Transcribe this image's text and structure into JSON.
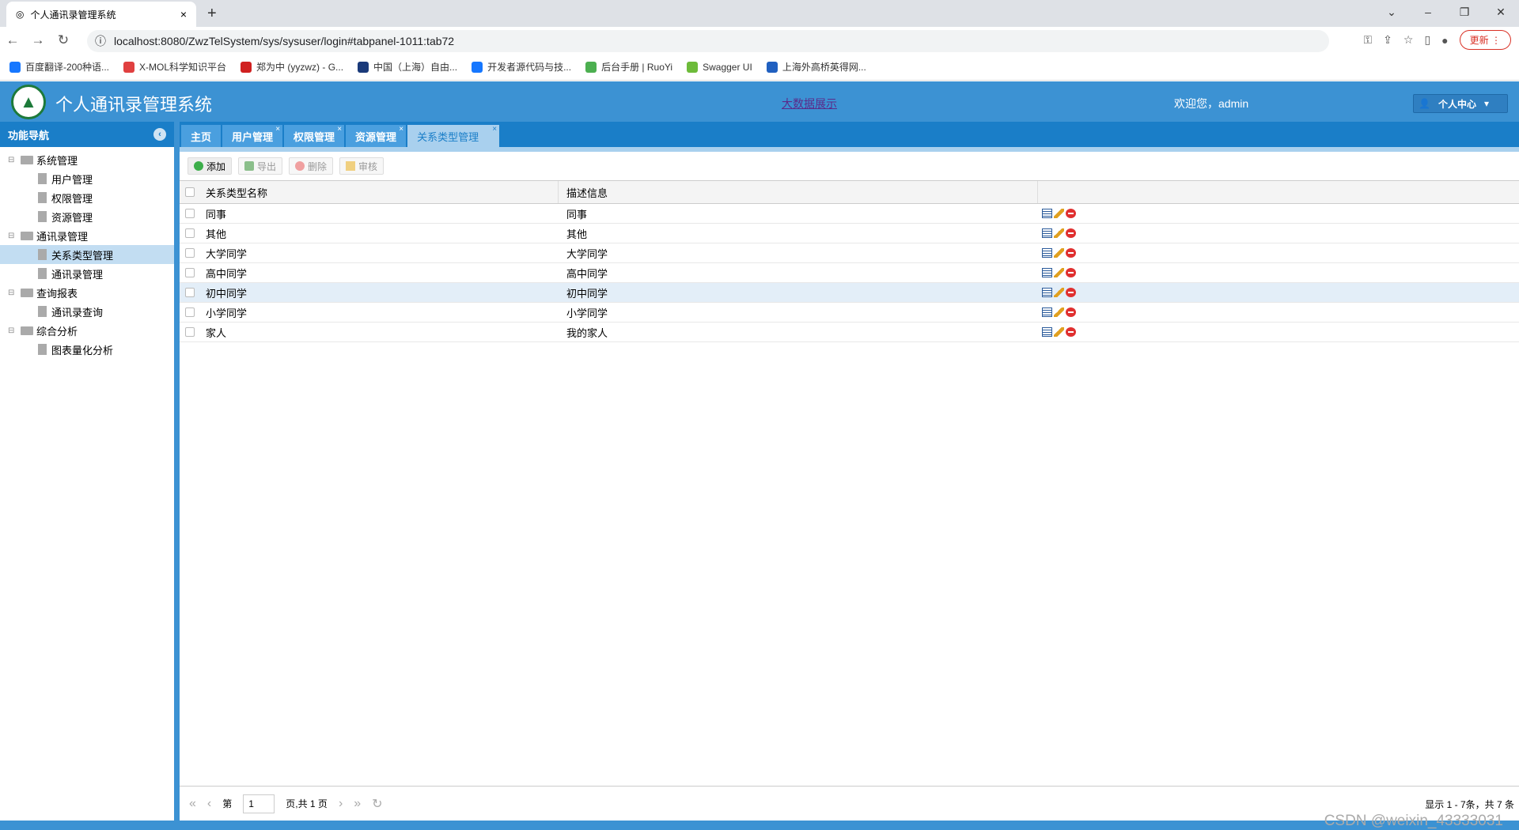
{
  "browser": {
    "tab_title": "个人通讯录管理系统",
    "url": "localhost:8080/ZwzTelSystem/sys/sysuser/login#tabpanel-1011:tab72",
    "update_label": "更新",
    "bookmarks": [
      "百度翻译-200种语...",
      "X-MOL科学知识平台",
      "郑为中 (yyzwz) - G...",
      "中国（上海）自由...",
      "开发者源代码与技...",
      "后台手册 | RuoYi",
      "Swagger UI",
      "上海外高桥英得网..."
    ]
  },
  "header": {
    "title": "个人通讯录管理系统",
    "bigdata_link": "大数据展示",
    "welcome": "欢迎您，admin",
    "personal_center": "个人中心"
  },
  "sidebar": {
    "title": "功能导航",
    "tree": [
      {
        "label": "系统管理",
        "children": [
          "用户管理",
          "权限管理",
          "资源管理"
        ]
      },
      {
        "label": "通讯录管理",
        "children": [
          "关系类型管理",
          "通讯录管理"
        ]
      },
      {
        "label": "查询报表",
        "children": [
          "通讯录查询"
        ]
      },
      {
        "label": "综合分析",
        "children": [
          "图表量化分析"
        ]
      }
    ],
    "selected": "关系类型管理"
  },
  "tabs": [
    {
      "label": "主页",
      "closable": false
    },
    {
      "label": "用户管理",
      "closable": true
    },
    {
      "label": "权限管理",
      "closable": true
    },
    {
      "label": "资源管理",
      "closable": true
    },
    {
      "label": "关系类型管理",
      "closable": true,
      "active": true
    }
  ],
  "toolbar": {
    "add": "添加",
    "export": "导出",
    "delete": "删除",
    "audit": "审核"
  },
  "grid": {
    "columns": [
      "关系类型名称",
      "描述信息"
    ],
    "rows": [
      [
        "同事",
        "同事"
      ],
      [
        "其他",
        "其他"
      ],
      [
        "大学同学",
        "大学同学"
      ],
      [
        "高中同学",
        "高中同学"
      ],
      [
        "初中同学",
        "初中同学"
      ],
      [
        "小学同学",
        "小学同学"
      ],
      [
        "家人",
        "我的家人"
      ]
    ],
    "highlighted_row": 4
  },
  "pager": {
    "page_prefix": "第",
    "page": "1",
    "page_suffix": "页,共 1 页",
    "info": "显示 1 - 7条，共 7 条"
  },
  "watermark": "CSDN @weixin_43333031"
}
